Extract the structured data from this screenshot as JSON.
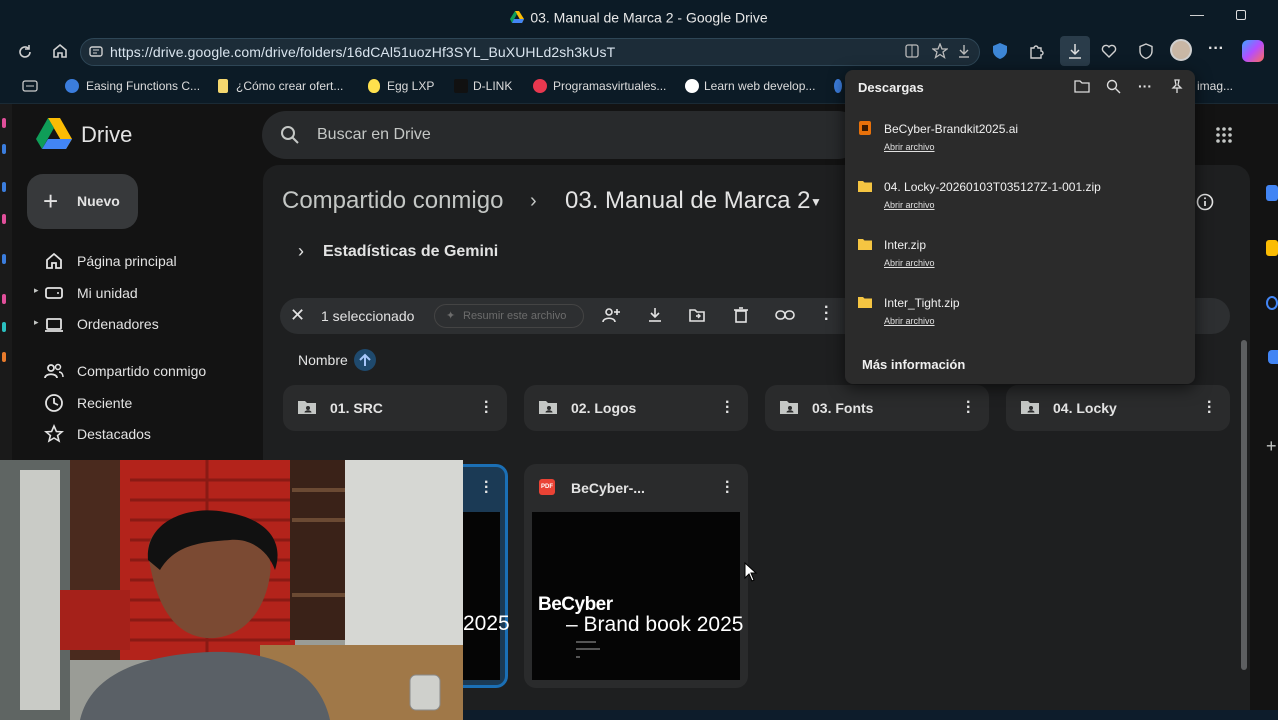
{
  "browser": {
    "window_title": "03. Manual de Marca 2 - Google Drive",
    "url": "https://drive.google.com/drive/folders/16dCAl51uozHf3SYL_BuXUHLd2sh3kUsT",
    "bookmarks": [
      "Easing Functions C...",
      "¿Cómo crear ofert...",
      "Egg LXP",
      "D-LINK",
      "Programasvirtuales...",
      "Learn web develop...",
      "imag..."
    ]
  },
  "drive": {
    "app_name": "Drive",
    "search_placeholder": "Buscar en Drive",
    "new_button": "Nuevo",
    "nav": {
      "home": "Página principal",
      "my_drive": "Mi unidad",
      "computers": "Ordenadores",
      "shared": "Compartido conmigo",
      "recent": "Reciente",
      "starred": "Destacados"
    },
    "breadcrumb": {
      "parent": "Compartido conmigo",
      "current": "03. Manual de Marca 2"
    },
    "gemini_stats": "Estadísticas de Gemini",
    "selection": {
      "count_label": "1 seleccionado",
      "summarize": "Resumir este archivo"
    },
    "sort_label": "Nombre",
    "folders": [
      "01. SRC",
      "02. Logos",
      "03. Fonts",
      "04. Locky"
    ],
    "files": [
      {
        "thumb_text": "2025"
      },
      {
        "title": "BeCyber-...",
        "thumb_line1": "BeCyber",
        "thumb_line2": "– Brand book 2025"
      }
    ]
  },
  "downloads": {
    "title": "Descargas",
    "open_label": "Abrir archivo",
    "items": [
      {
        "name": "BeCyber-Brandkit2025.ai",
        "icon": "ai-file-icon"
      },
      {
        "name": "04. Locky-20260103T035127Z-1-001.zip",
        "icon": "zip-folder-icon"
      },
      {
        "name": "Inter.zip",
        "icon": "zip-folder-icon"
      },
      {
        "name": "Inter_Tight.zip",
        "icon": "zip-folder-icon"
      }
    ],
    "more_info": "Más información"
  }
}
